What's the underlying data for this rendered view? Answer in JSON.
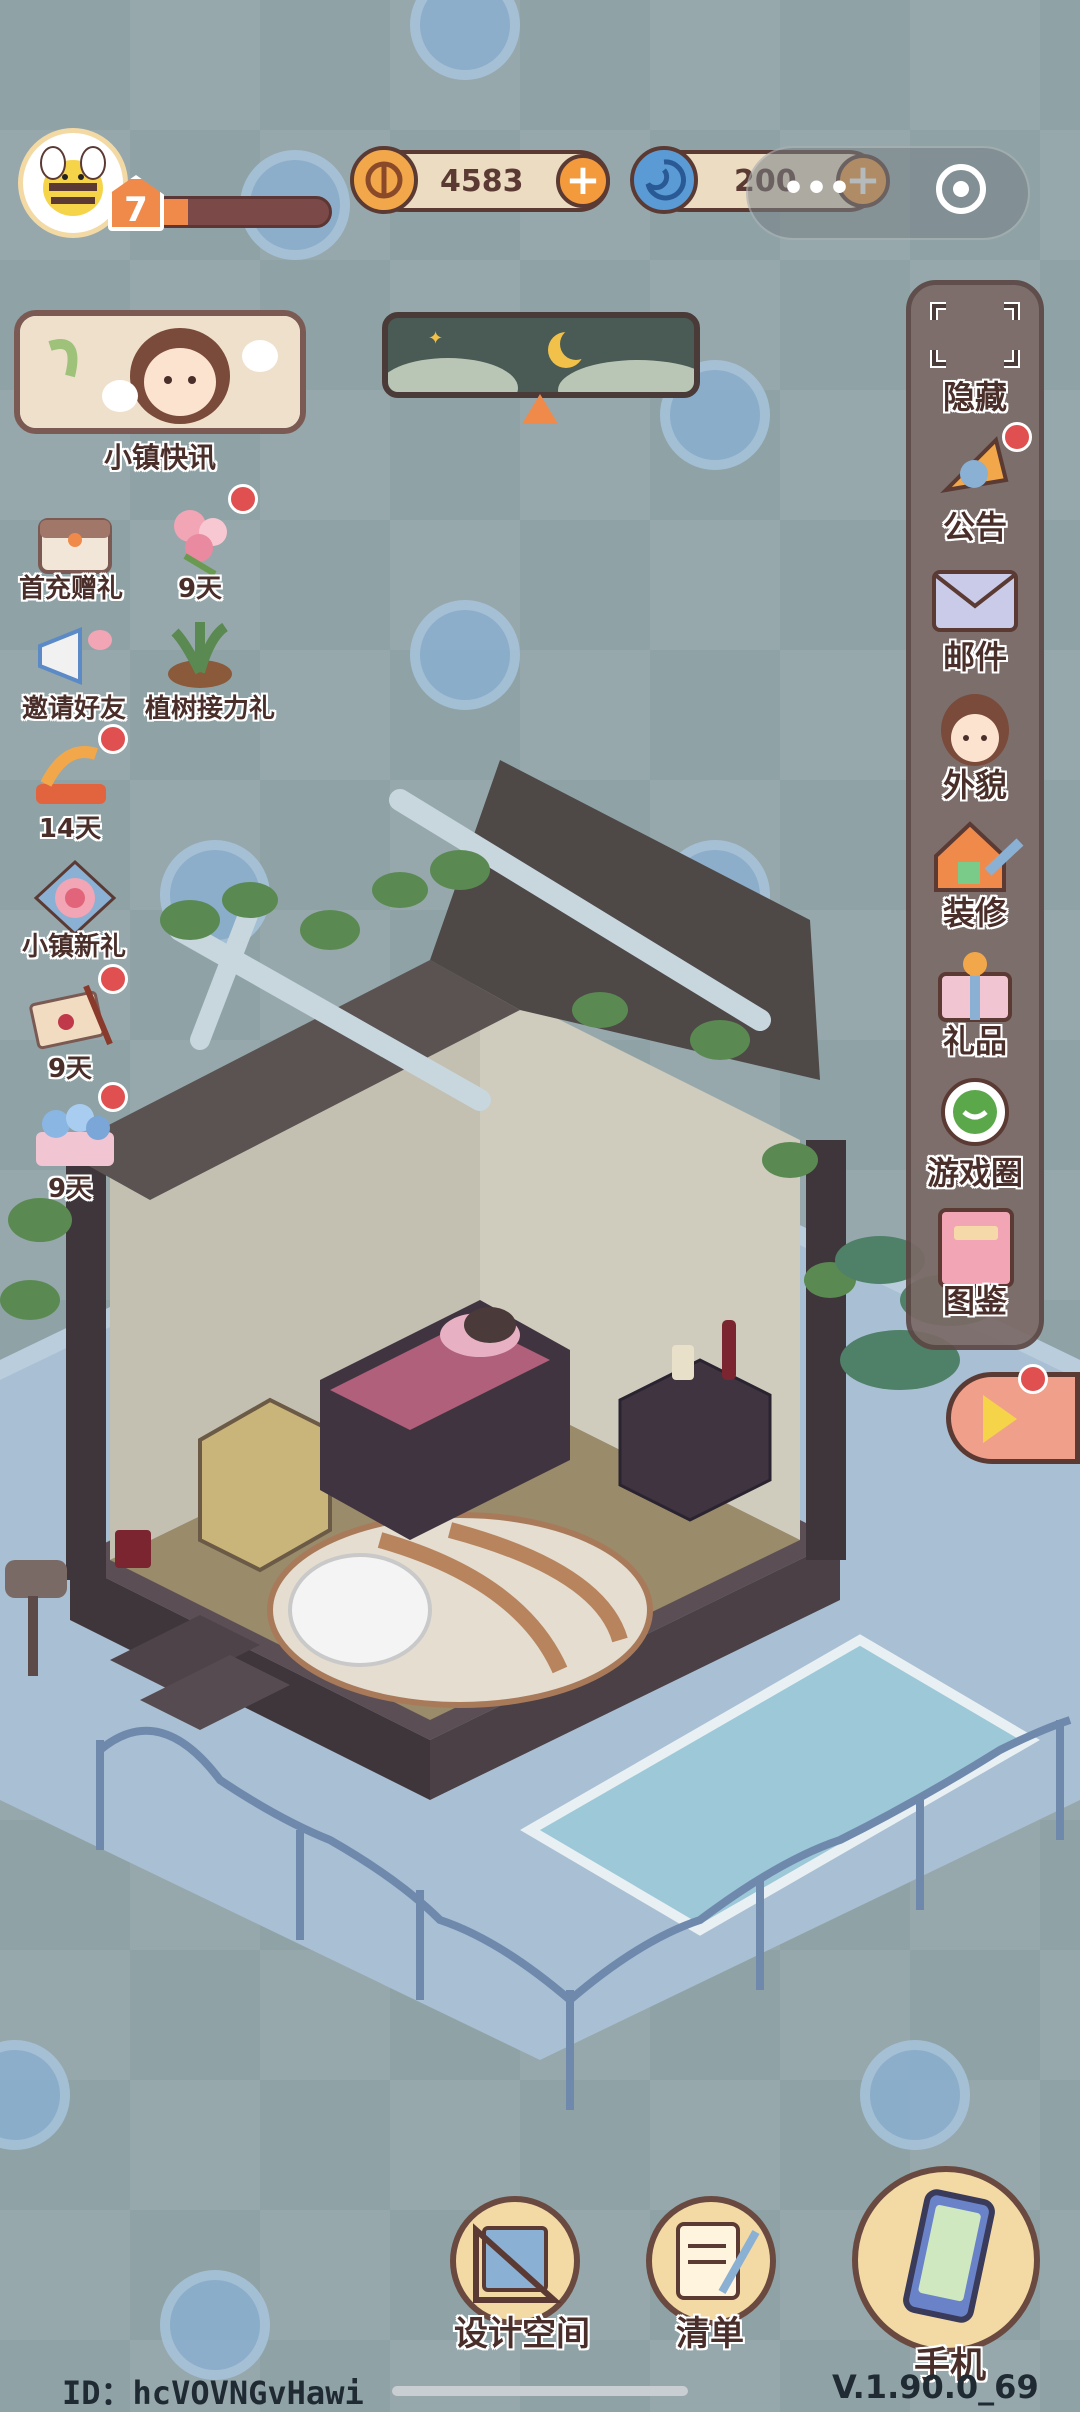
{
  "player": {
    "level": "7",
    "xp_progress": 0.2
  },
  "currencies": [
    {
      "name": "coins",
      "value": "4583",
      "icon": "coin-icon"
    },
    {
      "name": "gems",
      "value": "200",
      "icon": "swirl-gem-icon"
    }
  ],
  "system_capsule": {
    "more": "•••",
    "close": "◉"
  },
  "town_news": {
    "label": "小镇快讯"
  },
  "left_events": [
    {
      "label": "首充赠礼",
      "icon": "gift-box-icon",
      "dot": false
    },
    {
      "label": "9天",
      "icon": "flower-bouquet-icon",
      "dot": true
    },
    {
      "label": "邀请好友",
      "icon": "megaphone-icon",
      "dot": false
    },
    {
      "label": "植树接力礼",
      "icon": "plant-icon",
      "dot": false
    },
    {
      "label": "14天",
      "icon": "trophy-icon",
      "dot": true
    },
    {
      "label": "小镇新礼",
      "icon": "rose-frame-icon",
      "dot": false
    },
    {
      "label": "9天",
      "icon": "letter-icon",
      "dot": true
    },
    {
      "label": "9天",
      "icon": "blue-flowers-icon",
      "dot": true
    }
  ],
  "right_menu": [
    {
      "label": "隐藏",
      "icon": "hide-frame-icon",
      "dot": false
    },
    {
      "label": "公告",
      "icon": "announcement-icon",
      "dot": true
    },
    {
      "label": "邮件",
      "icon": "mail-icon",
      "dot": false
    },
    {
      "label": "外貌",
      "icon": "character-face-icon",
      "dot": false
    },
    {
      "label": "装修",
      "icon": "house-wrench-icon",
      "dot": false
    },
    {
      "label": "礼品",
      "icon": "gift-icon",
      "dot": false
    },
    {
      "label": "游戏圈",
      "icon": "chat-bubble-icon",
      "dot": false
    },
    {
      "label": "图鉴",
      "icon": "album-book-icon",
      "dot": false
    }
  ],
  "bottom_bar": {
    "design": "设计空间",
    "list": "清单",
    "phone": "手机"
  },
  "footer": {
    "id": "ID：hcVOVNGvHawi",
    "version": "V.1.90.0_69"
  },
  "colors": {
    "background": "#8fa3a6",
    "accent_orange": "#f08a4b",
    "badge_red": "#e05050",
    "panel_brown": "#5b3a34"
  }
}
